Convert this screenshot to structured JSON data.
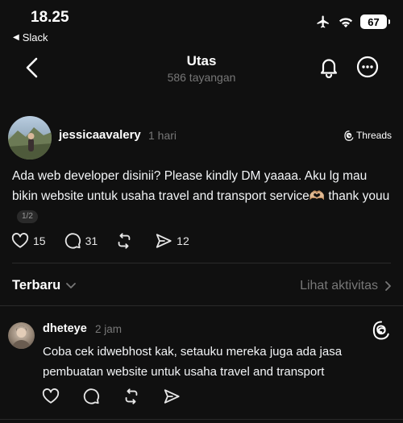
{
  "status_bar": {
    "time": "18.25",
    "back_app": "Slack",
    "battery": "67",
    "icons": [
      "airplane-icon",
      "wifi-icon",
      "battery-icon"
    ]
  },
  "nav": {
    "title": "Utas",
    "subtitle": "586 tayangan",
    "icons": [
      "chevron-left-icon",
      "bell-icon",
      "more-icon"
    ]
  },
  "post": {
    "author": "jessicaavalery",
    "time": "1 hari",
    "platform": "Threads",
    "text": "Ada web developer disinii? Please kindly DM yaaaa. Aku lg mau bikin website untuk usaha travel and transport service🫶🏼 thank youu",
    "page_indicator": "1/2",
    "likes": "15",
    "comments": "31",
    "reposts": "",
    "shares": "12"
  },
  "sort": {
    "label": "Terbaru",
    "activity_link": "Lihat aktivitas"
  },
  "reply": {
    "author": "dheteye",
    "time": "2 jam",
    "text": "Coba cek idwebhost kak, setauku mereka juga ada jasa pembuatan website untuk usaha travel and transport"
  },
  "colors": {
    "background": "#101010",
    "text": "#f3f5f7",
    "muted": "#777777",
    "divider": "#2a2a2a"
  }
}
